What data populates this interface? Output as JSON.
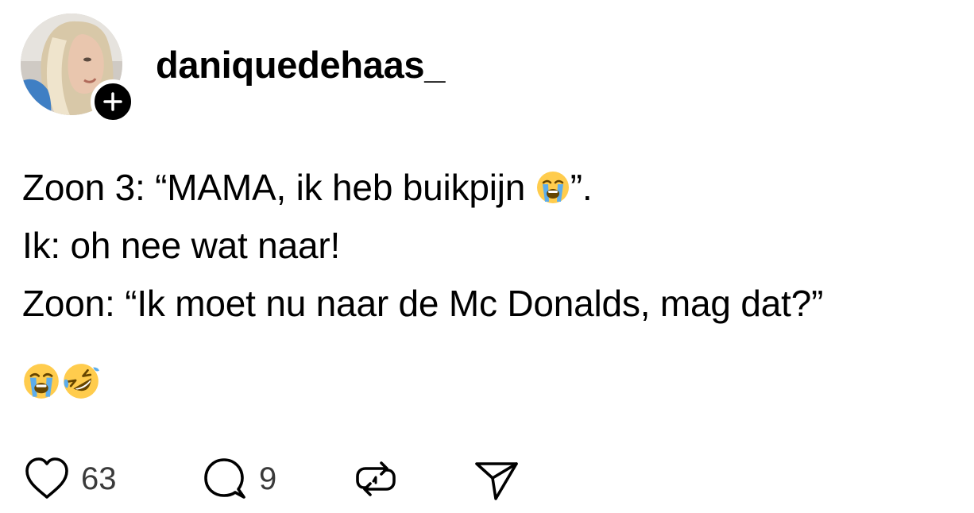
{
  "post": {
    "username": "daniquedehaas_",
    "lines": [
      {
        "before": "Zoon 3: “MAMA, ik heb buikpijn ",
        "emoji": "crying-face-emoji",
        "after": "”."
      },
      {
        "text": "Ik: oh nee wat naar!"
      },
      {
        "text": "Zoon: “Ik moet nu naar de Mc Donalds, mag dat?”"
      }
    ],
    "reaction_emojis": [
      "loudly-crying-face-emoji",
      "rolling-on-floor-laughing-emoji"
    ],
    "actions": {
      "like_count": "63",
      "reply_count": "9"
    }
  },
  "icons": {
    "like": "heart-icon",
    "reply": "comment-bubble-icon",
    "repost": "repost-icon",
    "share": "send-icon",
    "follow": "plus-icon"
  },
  "colors": {
    "text": "#000000",
    "count": "#3a3a3a",
    "badge": "#000000"
  }
}
